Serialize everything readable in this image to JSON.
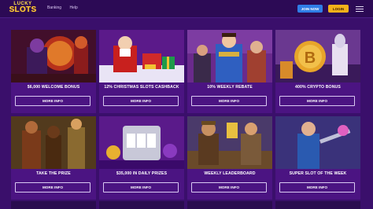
{
  "header": {
    "logo_top": "LUCKY",
    "logo_main": "SLOTS",
    "nav": [
      "Banking",
      "Help"
    ],
    "join_label": "JOIN NOW",
    "login_label": "LOGIN"
  },
  "cards": [
    {
      "title": "$6,000 WELCOME BONUS",
      "button": "MORE INFO"
    },
    {
      "title": "12% CHRISTMAS SLOTS CASHBACK",
      "button": "MORE INFO"
    },
    {
      "title": "10% WEEKLY REBATE",
      "button": "MORE INFO"
    },
    {
      "title": "400% CRYPTO BONUS",
      "button": "MORE INFO"
    },
    {
      "title": "TAKE THE PRIZE",
      "button": "MORE INFO"
    },
    {
      "title": "$35,000 IN DAILY PRIZES",
      "button": "MORE INFO"
    },
    {
      "title": "WEEKLY LEADERBOARD",
      "button": "MORE INFO"
    },
    {
      "title": "SUPER SLOT OF THE WEEK",
      "button": "MORE INFO"
    }
  ],
  "colors": {
    "background": "#3a0f6b",
    "card": "#4b1482",
    "join": "#2f7de6",
    "login": "#f3b11a"
  }
}
